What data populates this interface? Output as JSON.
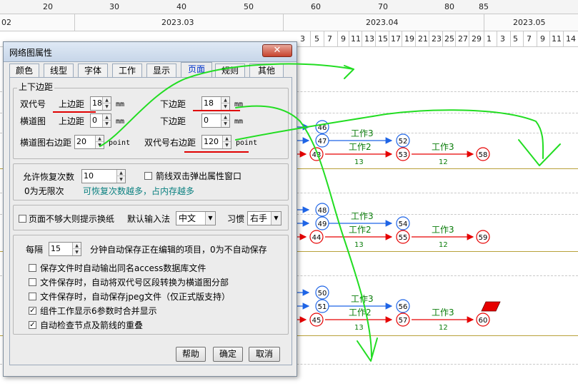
{
  "ruler": {
    "top_numbers": [
      {
        "label": "20"
      },
      {
        "label": "30"
      },
      {
        "label": "40"
      },
      {
        "label": "50"
      },
      {
        "label": "60"
      },
      {
        "label": "70"
      },
      {
        "label": "80"
      },
      {
        "label": "85"
      }
    ],
    "months": [
      {
        "label": "02"
      },
      {
        "label": "2023.03"
      },
      {
        "label": "2023.04"
      },
      {
        "label": "2023.05"
      }
    ],
    "days": [
      "3",
      "5",
      "7",
      "9",
      "11",
      "13",
      "15",
      "17",
      "19",
      "21",
      "23",
      "25",
      "27",
      "29",
      "1",
      "3",
      "5",
      "7",
      "9",
      "11",
      "14"
    ]
  },
  "network": {
    "nodes": [
      "46",
      "47",
      "52",
      "43",
      "53",
      "58",
      "48",
      "49",
      "54",
      "44",
      "55",
      "59",
      "50",
      "51",
      "56",
      "45",
      "57",
      "60"
    ],
    "work_label": "工作3",
    "work2_label": "工作2",
    "duration_13": "13",
    "duration_12": "12"
  },
  "dialog": {
    "title": "网络图属性",
    "close_label": "✕",
    "tabs": [
      "颜色",
      "线型",
      "字体",
      "工作",
      "显示",
      "页面",
      "规则",
      "其他"
    ],
    "active_tab": "页面",
    "margins_group": "上下边距",
    "row1_label": "双代号",
    "row2_label": "横道图",
    "top_margin_label": "上边距",
    "bottom_margin_label": "下边距",
    "unit_mm": "mm",
    "double_top_value": "18",
    "double_bottom_value": "18",
    "gantt_top_value": "0",
    "gantt_bottom_value": "0",
    "gantt_right_label": "横道图右边距",
    "gantt_right_value": "20",
    "unit_point": "point",
    "double_right_label": "双代号右边距",
    "double_right_value": "120",
    "undo_label": "允许恢复次数",
    "undo_value": "10",
    "undo_note": "0为无限次",
    "undo_hint": "可恢复次数越多，占内存越多",
    "arrow_dblclick_label": "箭线双击弹出属性窗口",
    "page_break_label": "页面不够大则提示换纸",
    "input_method_label": "默认输入法",
    "input_method_value": "中文",
    "habit_label": "习惯",
    "habit_value": "右手",
    "every_label": "每隔",
    "every_value": "15",
    "autosave_text": "分钟自动保存正在编辑的项目，0为不自动保存",
    "options": [
      {
        "label": "保存文件时自动输出同名access数据库文件",
        "checked": false
      },
      {
        "label": "文件保存时，自动将双代号区段转换为横道图分部",
        "checked": false
      },
      {
        "label": "文件保存时，自动保存jpeg文件（仅正式版支持）",
        "checked": false
      },
      {
        "label": "组件工作显示6参数时合并显示",
        "checked": true
      },
      {
        "label": "自动检查节点及箭线的重叠",
        "checked": true
      }
    ],
    "help_button": "帮助",
    "ok_button": "确定",
    "cancel_button": "取消"
  },
  "colors": {
    "node_blue": "#1e64e6",
    "node_red": "#e60000",
    "arrow_green": "#22dd22",
    "work_text": "#0a7d0a",
    "highlight_red": "#e00000"
  }
}
